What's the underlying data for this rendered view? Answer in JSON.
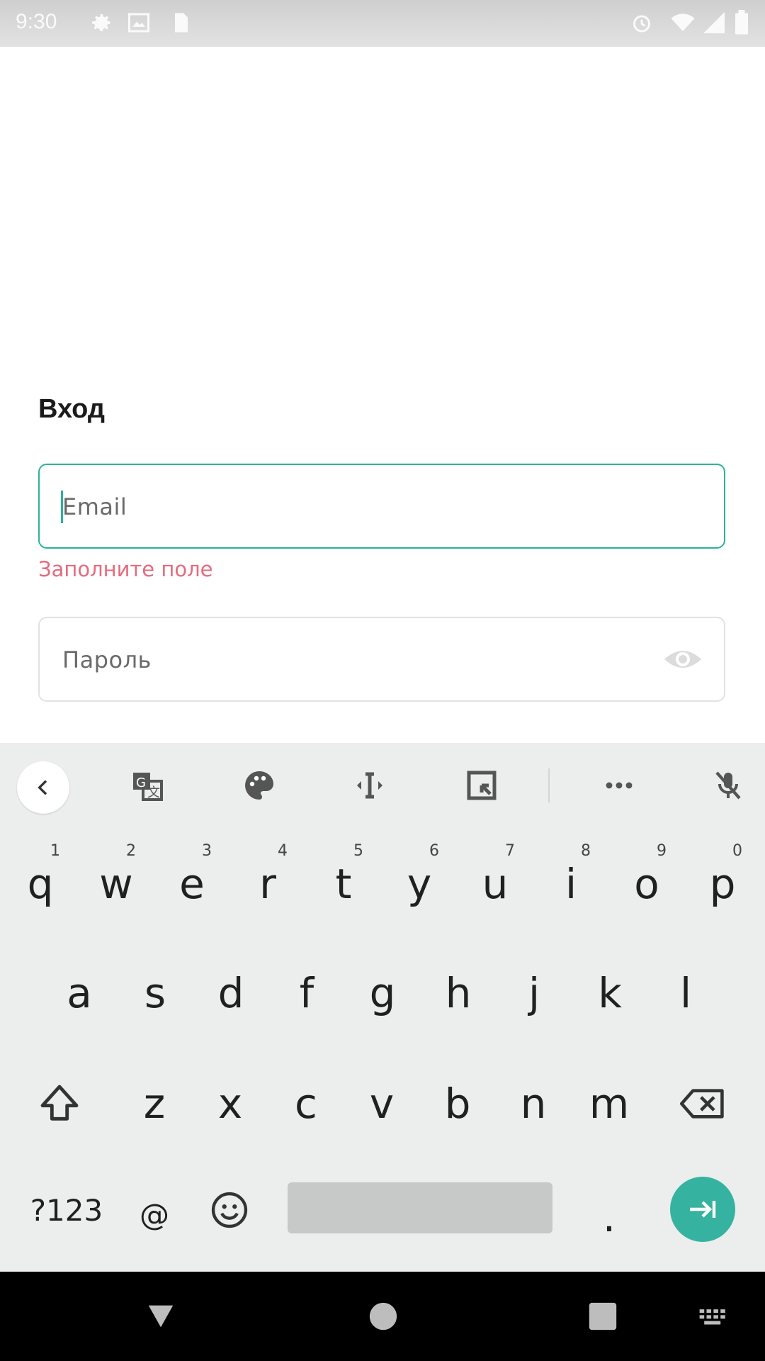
{
  "status_bar": {
    "time": "9:30",
    "left_icons": [
      "settings-icon",
      "gallery-icon",
      "sim-card-icon"
    ],
    "right_icons": [
      "alarm-icon",
      "wifi-icon",
      "signal-icon",
      "battery-icon"
    ]
  },
  "form": {
    "title": "Вход",
    "email": {
      "placeholder": "Email",
      "focused": true
    },
    "email_error": "Заполните поле",
    "password": {
      "placeholder": "Пароль",
      "toggle_icon": "eye-icon"
    }
  },
  "keyboard": {
    "toolbar": [
      "back-icon",
      "translate-icon",
      "palette-icon",
      "text-cursor-icon",
      "screenshot-icon",
      "more-icon",
      "mic-off-icon"
    ],
    "row1": [
      {
        "k": "q",
        "h": "1"
      },
      {
        "k": "w",
        "h": "2"
      },
      {
        "k": "e",
        "h": "3"
      },
      {
        "k": "r",
        "h": "4"
      },
      {
        "k": "t",
        "h": "5"
      },
      {
        "k": "y",
        "h": "6"
      },
      {
        "k": "u",
        "h": "7"
      },
      {
        "k": "i",
        "h": "8"
      },
      {
        "k": "o",
        "h": "9"
      },
      {
        "k": "p",
        "h": "0"
      }
    ],
    "row2": [
      "a",
      "s",
      "d",
      "f",
      "g",
      "h",
      "j",
      "k",
      "l"
    ],
    "row3": [
      "z",
      "x",
      "c",
      "v",
      "b",
      "n",
      "m"
    ],
    "row4": {
      "symbols": "?123",
      "at": "@",
      "period": "."
    },
    "accent_color": "#35b3a0"
  },
  "nav_bar": [
    "back-triangle-icon",
    "home-circle-icon",
    "recents-square-icon",
    "keyboard-switch-icon"
  ]
}
